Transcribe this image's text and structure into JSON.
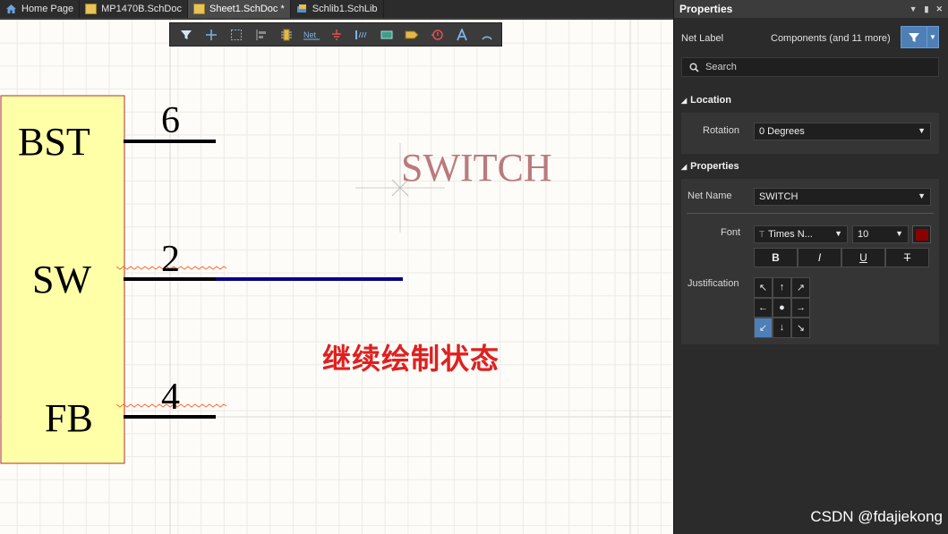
{
  "tabs": [
    {
      "label": "Home Page",
      "icon": "home-icon",
      "active": false
    },
    {
      "label": "MP1470B.SchDoc",
      "icon": "schdoc-icon",
      "active": false
    },
    {
      "label": "Sheet1.SchDoc *",
      "icon": "schdoc-icon",
      "active": true
    },
    {
      "label": "Schlib1.SchLib",
      "icon": "schlib-icon",
      "active": false
    }
  ],
  "toolbar": {
    "tools": [
      "filter-icon",
      "cross-icon",
      "select-rect-icon",
      "align-icon",
      "part-icon",
      "net-label-icon",
      "ground-icon",
      "bus-icon",
      "component-icon",
      "port-icon",
      "harness-icon",
      "text-icon",
      "arc-icon"
    ],
    "net_label_text": "Net"
  },
  "schematic": {
    "component_pins": [
      {
        "name": "BST",
        "number": "6"
      },
      {
        "name": "SW",
        "number": "2"
      },
      {
        "name": "FB",
        "number": "4"
      }
    ],
    "floating_net_label": "SWITCH",
    "body_color": "#ffffa8",
    "net_label_color": "#b97a7e",
    "wire_color": "#00008b"
  },
  "annotation": "继续绘制状态",
  "panel": {
    "title": "Properties",
    "object_kind": "Net Label",
    "filter_summary": "Components (and 11 more)",
    "search_placeholder": "Search",
    "location_section": "Location",
    "rotation_label": "Rotation",
    "rotation_value": "0 Degrees",
    "properties_section": "Properties",
    "net_name_label": "Net Name",
    "net_name_value": "SWITCH",
    "font_label": "Font",
    "font_name": "Times N...",
    "font_size": "10",
    "font_color": "#8b0000",
    "bold": "B",
    "italic": "I",
    "underline": "U",
    "strike": "T",
    "justification_label": "Justification",
    "justification_cells": [
      "↖",
      "↑",
      "↗",
      "←",
      "●",
      "→",
      "↙",
      "↓",
      "↘"
    ],
    "justification_selected": 6
  },
  "watermark": "CSDN @fdajiekong"
}
